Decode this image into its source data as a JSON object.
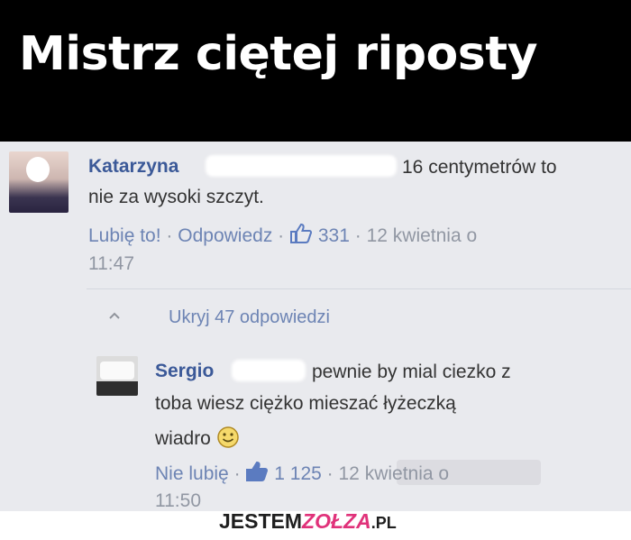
{
  "banner": {
    "title": "Mistrz ciętej riposty"
  },
  "comment": {
    "author": "Katarzyna",
    "text_line1": "16 centymetrów to",
    "text_line2": "nie za wysoki szczyt.",
    "like_label": "Lubię to!",
    "reply_label": "Odpowiedz",
    "separator": "·",
    "like_count": "331",
    "date": "12 kwietnia o",
    "time": "11:47"
  },
  "replies_toggle": {
    "label": "Ukryj 47 odpowiedzi"
  },
  "reply": {
    "author": "Sergio",
    "text_line1": "pewnie by mial ciezko z",
    "text_line2": "toba wiesz ciężko mieszać łyżeczką",
    "text_line3": "wiadro",
    "unlike_label": "Nie lubię",
    "like_count": "1 125",
    "date": "12 kwietnia o",
    "time": "11:50"
  },
  "footer": {
    "logo_part1": "JESTEM",
    "logo_part2": "ZOŁZA",
    "logo_part3": ".PL"
  },
  "colors": {
    "name": "#3b5998",
    "link": "#6d84b4",
    "panel": "#e9eaee",
    "brand_pink": "#e0327a"
  },
  "icons": {
    "like": "thumbs-up-icon",
    "smiley": "smiley-icon",
    "collapse": "chevron-up-icon"
  }
}
